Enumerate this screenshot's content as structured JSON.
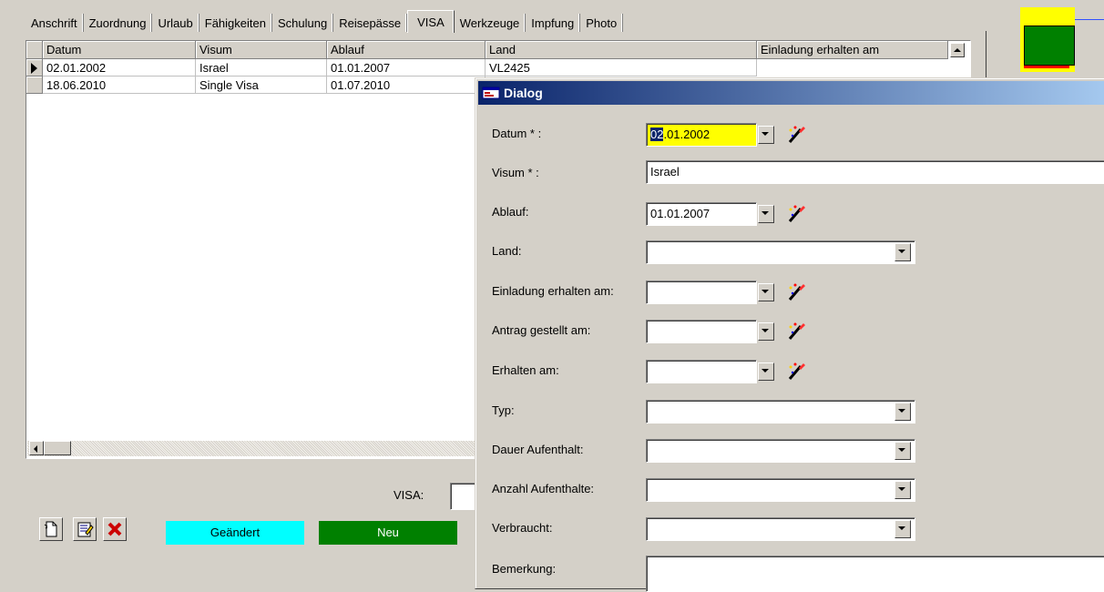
{
  "tabs": [
    "Anschrift",
    "Zuordnung",
    "Urlaub",
    "Fähigkeiten",
    "Schulung",
    "Reisepässe",
    "VISA",
    "Werkzeuge",
    "Impfung",
    "Photo"
  ],
  "active_tab": "VISA",
  "grid": {
    "columns": [
      "Datum",
      "Visum",
      "Ablauf",
      "Land",
      "Einladung erhalten am"
    ],
    "rows": [
      {
        "datum": "02.01.2002",
        "visum": "Israel",
        "ablauf": "01.01.2007",
        "land": "VL2425",
        "selected": true
      },
      {
        "datum": "18.06.2010",
        "visum": "Single Visa",
        "ablauf": "01.07.2010",
        "land": "",
        "selected": false
      }
    ]
  },
  "bottom": {
    "visa_label": "VISA:",
    "legend": [
      {
        "label": "Geändert",
        "color": "#00ffff"
      },
      {
        "label": "Neu",
        "color": "#008000"
      }
    ]
  },
  "dialog": {
    "title": "Dialog",
    "fields": [
      {
        "label": "Datum * :",
        "value_sel": "02",
        "value_rest": ".01.2002",
        "kind": "date",
        "highlight": "#ffff00"
      },
      {
        "label": "Visum * :",
        "value": "Israel",
        "kind": "text"
      },
      {
        "label": "Ablauf:",
        "value": "01.01.2007",
        "kind": "date"
      },
      {
        "label": "Land:",
        "value": "",
        "kind": "combo"
      },
      {
        "label": "Einladung erhalten am:",
        "value": "",
        "kind": "date"
      },
      {
        "label": "Antrag gestellt am:",
        "value": "",
        "kind": "date"
      },
      {
        "label": "Erhalten am:",
        "value": "",
        "kind": "date"
      },
      {
        "label": "Typ:",
        "value": "",
        "kind": "combo"
      },
      {
        "label": "Dauer Aufenthalt:",
        "value": "",
        "kind": "combo"
      },
      {
        "label": "Anzahl Aufenthalte:",
        "value": "",
        "kind": "combo"
      },
      {
        "label": "Verbraucht:",
        "value": "",
        "kind": "combo"
      },
      {
        "label": "Bemerkung:",
        "value": "",
        "kind": "text"
      }
    ]
  },
  "colors": {
    "title_start": "#0a246a",
    "title_end": "#a6caf0",
    "face": "#d4d0c8"
  }
}
